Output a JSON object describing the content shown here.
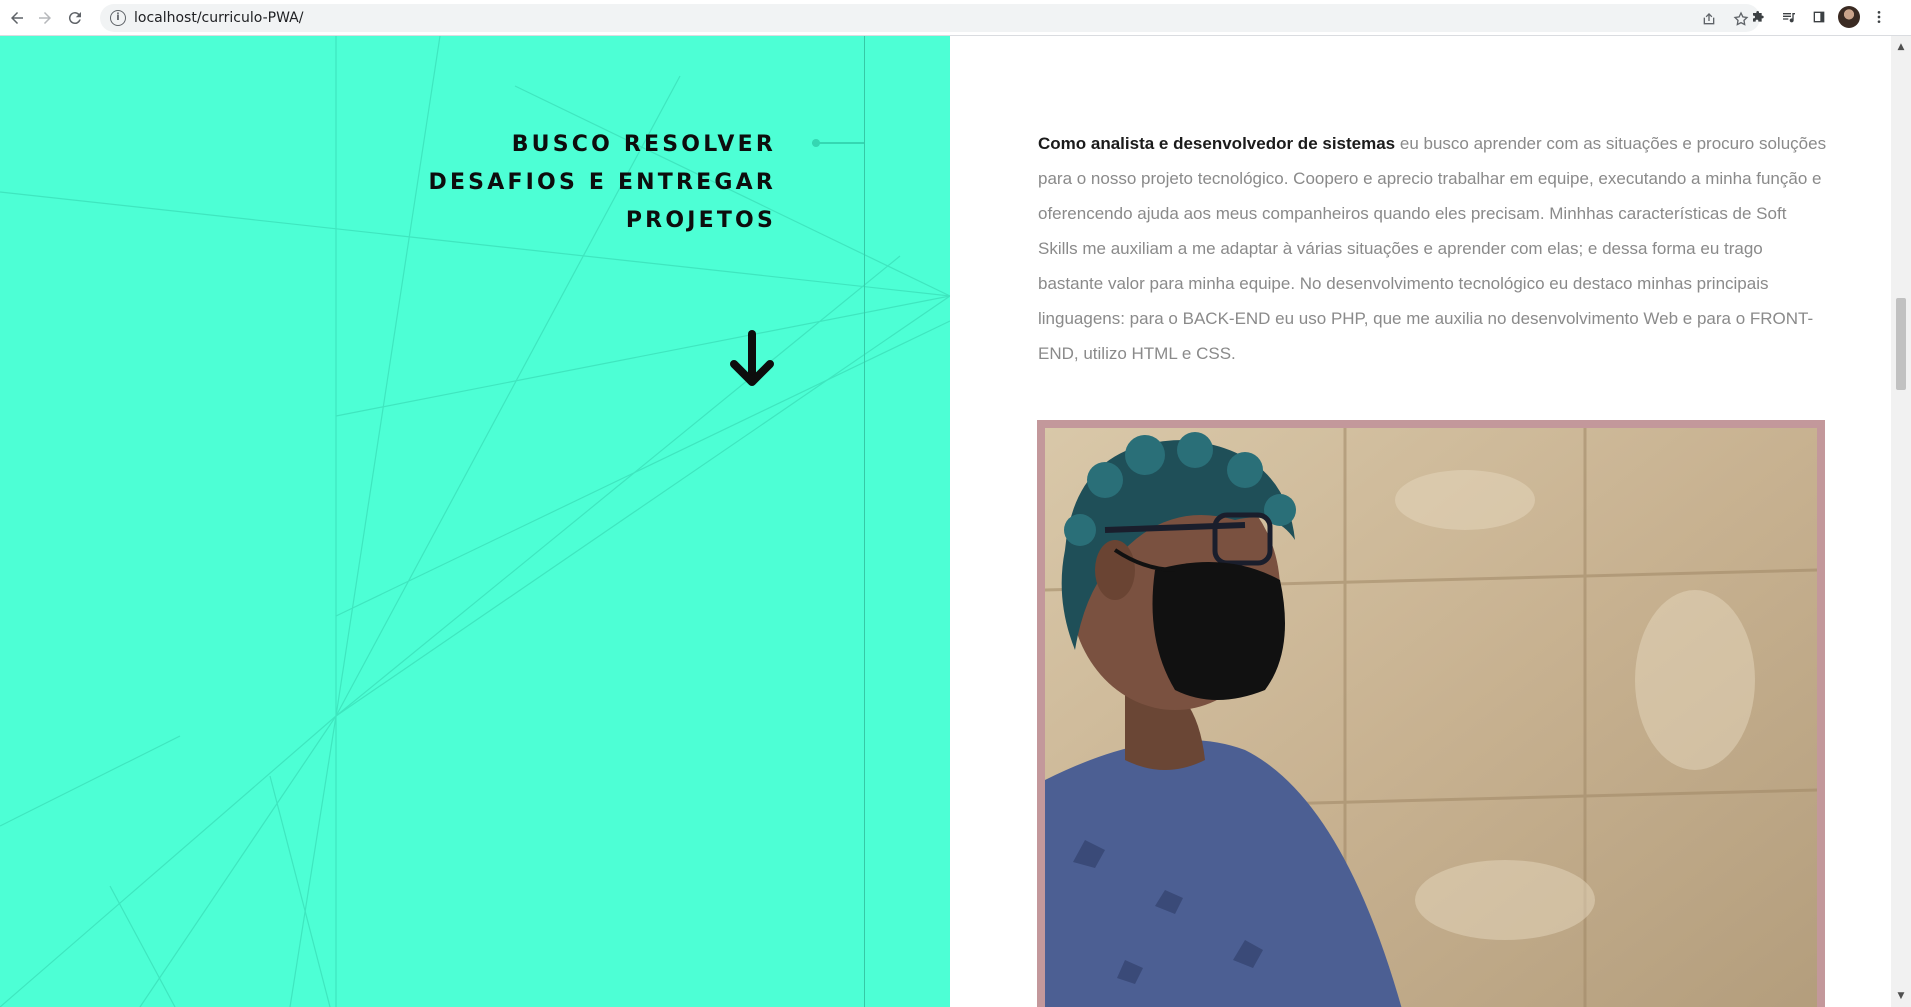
{
  "browser": {
    "url": "localhost/curriculo-PWA/",
    "info_symbol": "i"
  },
  "hero": {
    "headline_lines": [
      "BUSCO RESOLVER",
      "DESAFIOS E ENTREGAR",
      "PROJETOS"
    ],
    "accent_color": "#4dffd5"
  },
  "about": {
    "bold_intro": "Como analista e desenvolvedor de sistemas",
    "body": " eu busco aprender com as situações e procuro soluções para o nosso projeto tecnológico. Coopero e aprecio trabalhar em equipe, executando a minha função e oferencendo ajuda aos meus companheiros quando eles precisam. Minhhas características de Soft Skills me auxiliam a me adaptar à várias situações e aprender com elas; e dessa forma eu trago bastante valor para minha equipe. No desenvolvimento tecnológico eu destaco minhas principais linguagens: para o BACK-END eu uso PHP, que me auxilia no desenvolvimento Web e para o FRONT-END, utilizo HTML e CSS."
  },
  "photo": {
    "frame_color": "#c3989b"
  }
}
